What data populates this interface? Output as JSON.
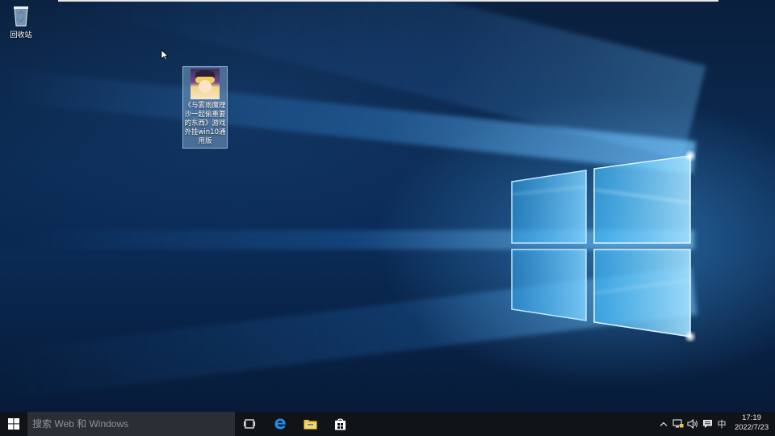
{
  "desktop": {
    "icons": [
      {
        "label": "回收站",
        "icon": "recycle-bin-icon"
      },
      {
        "label": "《与雾雨魔理沙一起偷重要的东西》游戏外挂win10通用版",
        "icon": "game-thumbnail"
      }
    ]
  },
  "taskbar": {
    "search_placeholder": "搜索 Web 和 Windows",
    "pinned": [
      {
        "name": "task-view",
        "icon": "task-view-icon"
      },
      {
        "name": "edge",
        "icon": "edge-icon"
      },
      {
        "name": "file-explorer",
        "icon": "folder-icon"
      },
      {
        "name": "store",
        "icon": "store-icon"
      }
    ],
    "tray": {
      "ime": "中",
      "time": "17:19",
      "date": "2022/7/23"
    }
  },
  "colors": {
    "taskbar_bg": "#101419",
    "search_bg": "#2b2f35",
    "edge_blue": "#1e90e6",
    "explorer_yellow": "#f2c53d"
  }
}
